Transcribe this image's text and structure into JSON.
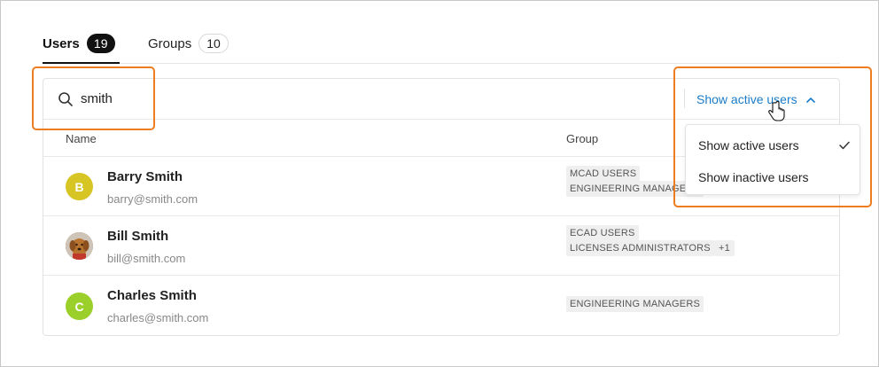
{
  "tabs": [
    {
      "label": "Users",
      "count": "19"
    },
    {
      "label": "Groups",
      "count": "10"
    }
  ],
  "search": {
    "value": "smith"
  },
  "filter": {
    "label": "Show active users"
  },
  "columns": {
    "name": "Name",
    "group": "Group"
  },
  "users": [
    {
      "avatar_letter": "B",
      "avatar_color": "#d6c523",
      "name": "Barry Smith",
      "email": "barry@smith.com",
      "groups": [
        "MCAD USERS",
        "ENGINEERING MANAGERS"
      ]
    },
    {
      "avatar_color": "#8a5a3a",
      "name": "Bill Smith",
      "email": "bill@smith.com",
      "groups": [
        "ECAD USERS",
        "LICENSES ADMINISTRATORS"
      ],
      "more": "+1"
    },
    {
      "avatar_letter": "C",
      "avatar_color": "#9bcf2a",
      "name": "Charles Smith",
      "email": "charles@smith.com",
      "groups": [
        "ENGINEERING MANAGERS"
      ]
    }
  ],
  "dropdown": {
    "items": [
      {
        "label": "Show active users",
        "selected": true
      },
      {
        "label": "Show inactive users",
        "selected": false
      }
    ]
  },
  "colors": {
    "accent": "#1a7cc9",
    "highlight": "#ee7d22",
    "tab_badge": "#111111"
  }
}
